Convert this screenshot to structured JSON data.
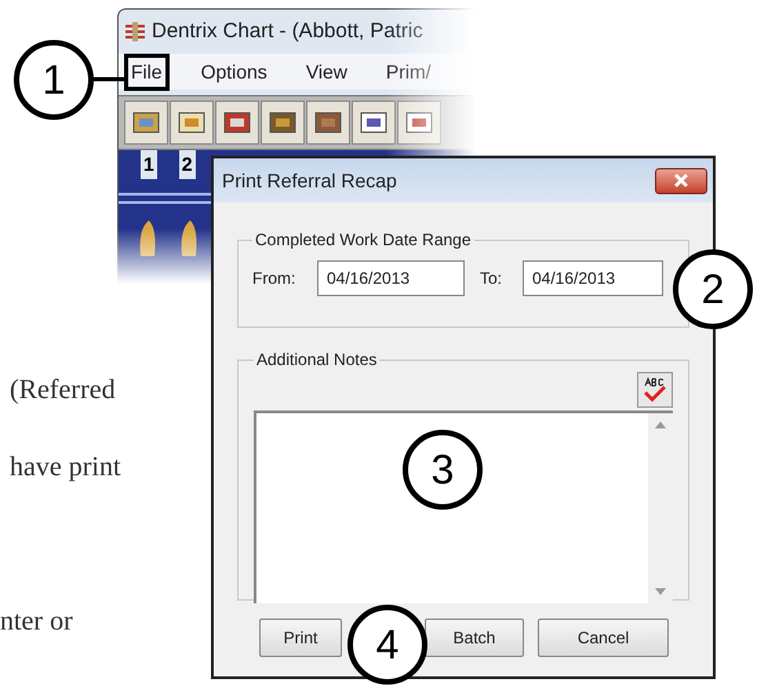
{
  "page_text": [
    "(Referred",
    "have print",
    "nter or"
  ],
  "background_window": {
    "title": "Dentrix Chart - (Abbott, Patric",
    "menu": [
      {
        "label": "File",
        "highlighted": true
      },
      {
        "label": "Options",
        "highlighted": false
      },
      {
        "label": "View",
        "highlighted": false
      },
      {
        "label": "Prim/",
        "highlighted": false
      }
    ],
    "chart_header": [
      "1",
      "2"
    ]
  },
  "dialog": {
    "title": "Print Referral Recap",
    "date_group": {
      "label": "Completed Work Date Range",
      "from_label": "From:",
      "from_value": "04/16/2013",
      "to_label": "To:",
      "to_value": "04/16/2013"
    },
    "notes_group": {
      "label": "Additional Notes"
    },
    "buttons": [
      "Print",
      "Batch",
      "Cancel"
    ]
  },
  "callouts": [
    "1",
    "2",
    "3",
    "4"
  ]
}
